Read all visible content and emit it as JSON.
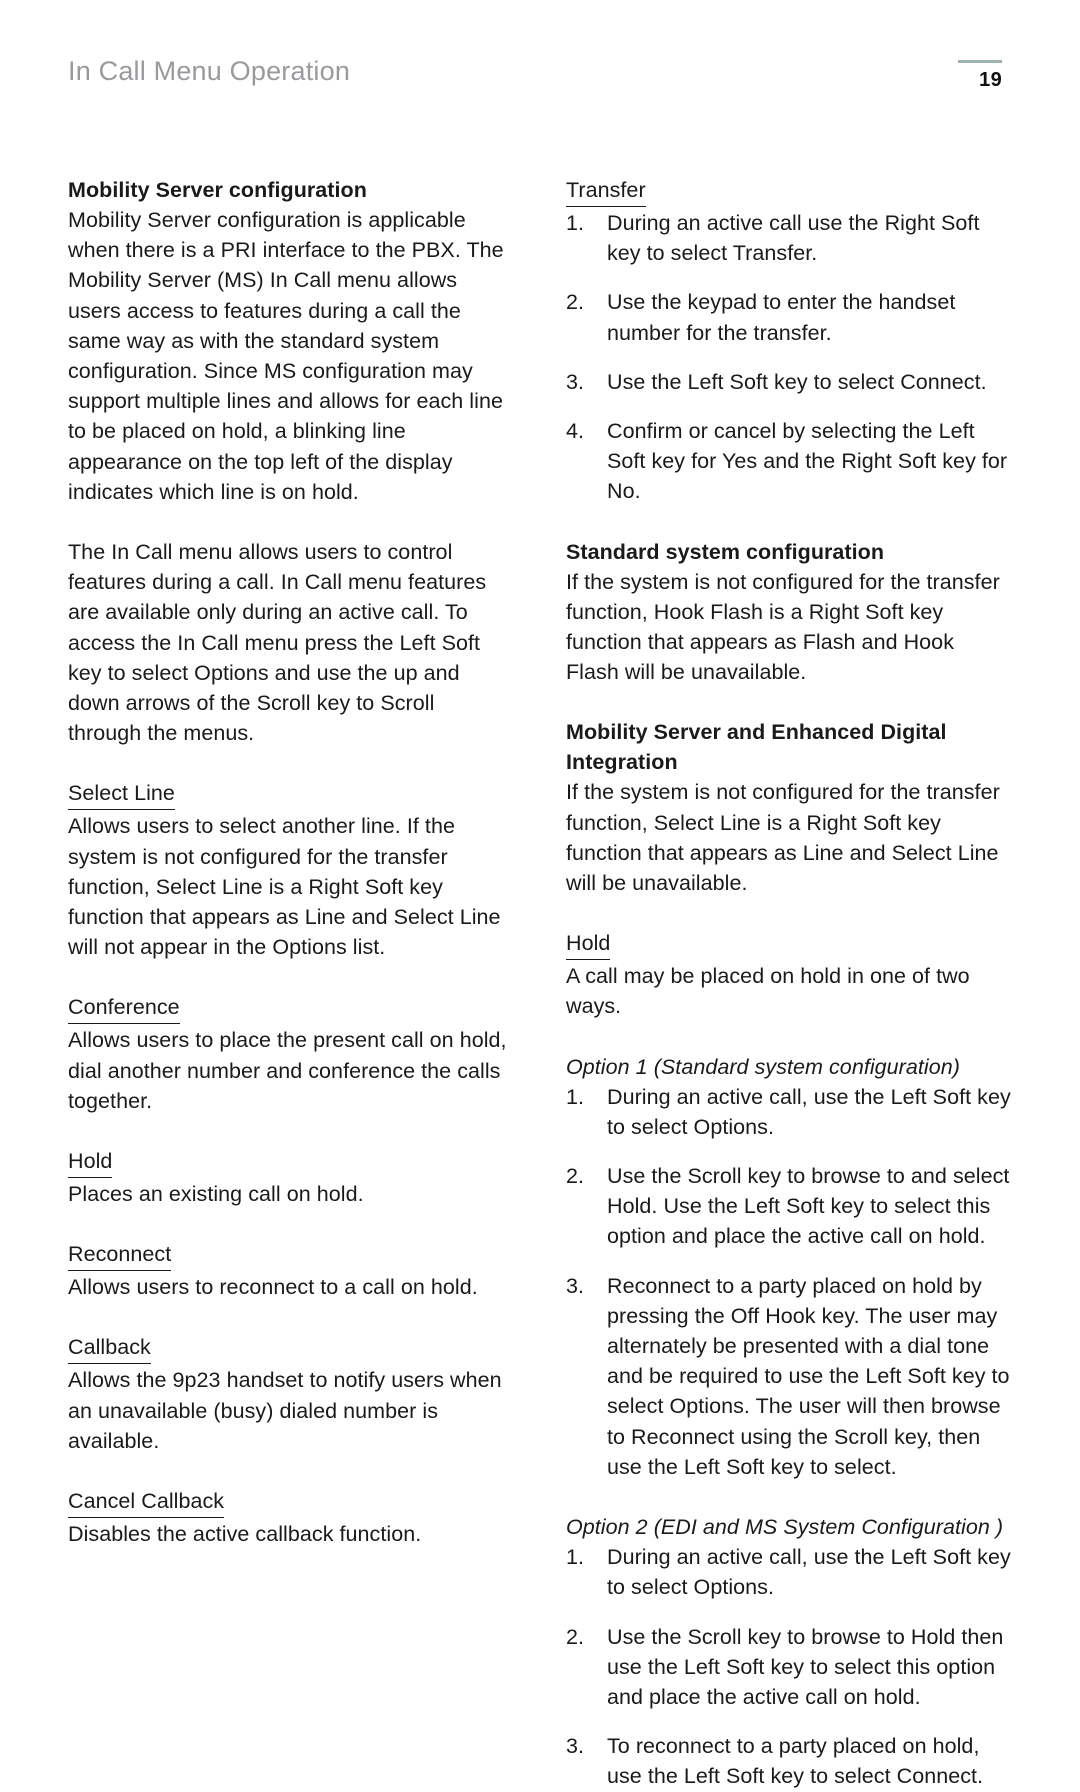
{
  "header": {
    "running_title": "In Call Menu Operation",
    "page_number": "19",
    "rule_color": "#9fb3b3",
    "title_color": "#9a9a9e"
  },
  "left_column": {
    "section_mobility": {
      "heading": "Mobility Server configuration",
      "paragraph_1": "Mobility Server configuration is applicable when there is a PRI interface to the PBX. The Mobility Server (MS) In Call menu allows users access to features during a call the same way as with the standard system configuration. Since MS configuration may support multiple lines and allows for each line to be placed on hold, a blinking line appearance on the top left of the display indicates which line is on hold.",
      "paragraph_2": "The In Call menu allows users to control features during a call. In Call menu features are available only during an active call. To access the In Call menu press the Left Soft key to select Options and use the up and down arrows of the Scroll key to Scroll through the menus."
    },
    "entries": [
      {
        "heading": "Select Line",
        "body": "Allows users to select another line. If the system is not configured for the transfer function, Select Line is a Right Soft key function that appears as Line and Select Line will not appear in the Options list."
      },
      {
        "heading": "Conference",
        "body": "Allows users to place the present call on hold, dial another number and conference the calls together."
      },
      {
        "heading": "Hold",
        "body": "Places an existing call on hold."
      },
      {
        "heading": "Reconnect",
        "body": "Allows users to reconnect to a call on hold."
      },
      {
        "heading": "Callback",
        "body": "Allows the 9p23 handset to notify users when an unavailable (busy) dialed number is available."
      },
      {
        "heading": "Cancel Callback",
        "body": "Disables the active callback function."
      }
    ]
  },
  "right_column": {
    "transfer": {
      "heading": "Transfer",
      "steps": [
        {
          "number": "1.",
          "text": "During an active call use the Right Soft key to select Transfer."
        },
        {
          "number": "2.",
          "text": "Use the keypad to enter the handset number for the transfer."
        },
        {
          "number": "3.",
          "text": "Use the Left Soft key to select Connect."
        },
        {
          "number": "4.",
          "text": "Confirm or cancel by selecting the Left Soft key for Yes and the Right Soft key for No."
        }
      ]
    },
    "standard_system": {
      "heading": "Standard system configuration",
      "body": "If the system is not configured for the transfer function, Hook Flash is a Right Soft key function that appears as Flash and Hook Flash will be unavailable."
    },
    "mobility_edi": {
      "heading": "Mobility Server and Enhanced Digital Integration",
      "body": "If the system is not configured for the transfer function, Select Line is a Right Soft key function that appears as Line and Select Line will be unavailable."
    },
    "hold": {
      "heading": "Hold",
      "body": "A call may be placed on hold in one of two ways."
    },
    "option_1": {
      "heading": "Option 1 (Standard system configuration)",
      "steps": [
        {
          "number": "1.",
          "text": "During an active call, use the Left Soft key to select Options."
        },
        {
          "number": "2.",
          "text": "Use the Scroll key to browse to and select Hold. Use the Left Soft key to select this option and place the active call on hold."
        },
        {
          "number": "3.",
          "text": "Reconnect to a party placed on hold by pressing the Off Hook key. The user may alternately be presented with a dial tone and be required to use the Left Soft key to select Options. The user will then browse to Reconnect using the Scroll key, then use the Left Soft key to select."
        }
      ]
    },
    "option_2": {
      "heading": "Option 2 (EDI and MS System Configuration )",
      "steps": [
        {
          "number": "1.",
          "text": "During an active call, use the Left Soft key to select Options."
        },
        {
          "number": "2.",
          "text": "Use the Scroll key to browse to Hold then use the Left Soft key to select this option and place the active call on hold."
        },
        {
          "number": "3.",
          "text": "To reconnect to a party placed on hold, use the Left Soft key to select Connect."
        }
      ]
    }
  }
}
